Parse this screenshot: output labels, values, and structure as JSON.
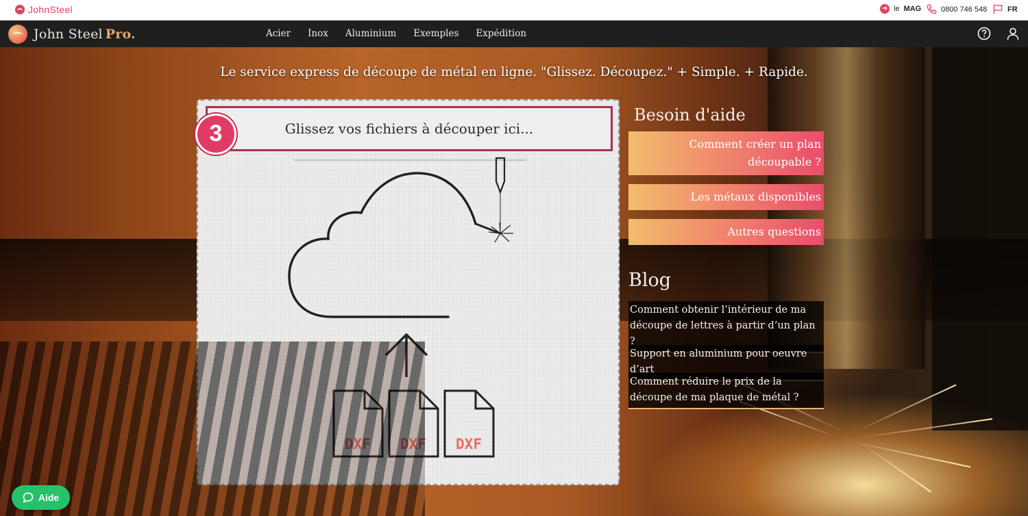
{
  "topbar": {
    "brand": "JohnSteel",
    "mag_prefix": "le",
    "mag": "MAG",
    "phone": "0800 746 548",
    "language": "FR"
  },
  "navbar": {
    "logo_text": "John Steel",
    "logo_pro": "Pro.",
    "links": [
      "Acier",
      "Inox",
      "Aluminium",
      "Exemples",
      "Expédition"
    ],
    "icons": [
      "help-circle-icon",
      "user-icon"
    ]
  },
  "hero": {
    "tagline": "Le service express de découpe de métal en ligne. \"Glissez. Découpez.\" + Simple. + Rapide."
  },
  "dropzone": {
    "step_number": "3",
    "title": "Glissez vos fichiers à découper ici...",
    "file_labels": [
      "DXF",
      "DXF",
      "DXF"
    ]
  },
  "help": {
    "title": "Besoin d'aide",
    "items": [
      "Comment créer un plan découpable ?",
      "Les métaux disponibles",
      "Autres questions"
    ]
  },
  "blog": {
    "title": "Blog",
    "items": [
      "Comment obtenir l’intérieur de ma découpe de lettres à partir d’un plan ?",
      "Support en aluminium pour oeuvre d’art",
      "Comment réduire le prix de la découpe de ma plaque de métal ?"
    ]
  },
  "chat": {
    "label": "Aide"
  },
  "colors": {
    "brand_pink": "#e23a66",
    "header_border": "#a8304f",
    "gradient_start": "#f2bd6d",
    "gradient_end": "#ea4c6c",
    "chat_green": "#25c26a",
    "nav_bg": "#1f1f1f"
  }
}
